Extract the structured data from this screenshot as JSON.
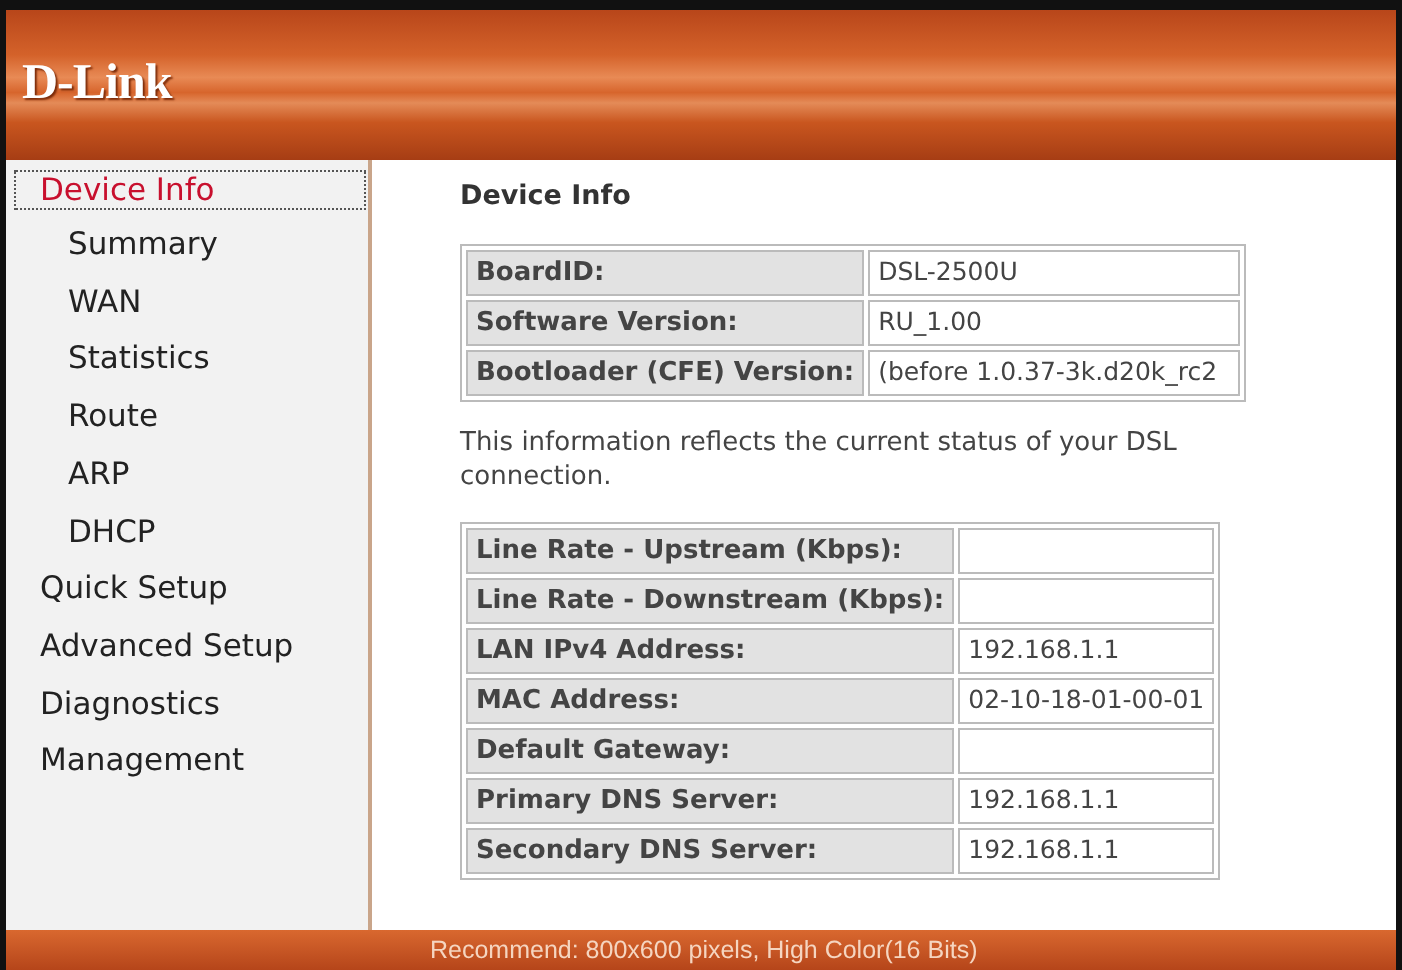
{
  "header": {
    "logo": "D-Link"
  },
  "sidebar": {
    "items": [
      {
        "label": "Device Info",
        "selected": true,
        "children": [
          {
            "label": "Summary",
            "selected": false
          },
          {
            "label": "WAN",
            "selected": false
          },
          {
            "label": "Statistics",
            "selected": false
          },
          {
            "label": "Route",
            "selected": false
          },
          {
            "label": "ARP",
            "selected": false
          },
          {
            "label": "DHCP",
            "selected": false
          }
        ]
      },
      {
        "label": "Quick Setup",
        "selected": false
      },
      {
        "label": "Advanced Setup",
        "selected": false
      },
      {
        "label": "Diagnostics",
        "selected": false
      },
      {
        "label": "Management",
        "selected": false
      }
    ]
  },
  "content": {
    "title": "Device Info",
    "info_table": [
      {
        "label": "BoardID:",
        "value": "DSL-2500U"
      },
      {
        "label": "Software Version:",
        "value": "RU_1.00"
      },
      {
        "label": "Bootloader (CFE) Version:",
        "value": "(before 1.0.37-3k.d20k_rc2"
      }
    ],
    "description": "This information reflects the current status of your DSL connection.",
    "status_table": [
      {
        "label": "Line Rate - Upstream (Kbps):"
      },
      {
        "label": "Line Rate - Downstream (Kbps):"
      },
      {
        "label": "LAN IPv4 Address:",
        "value": "192.168.1.1"
      },
      {
        "label": "MAC Address:",
        "value": "02-10-18-01-00-01"
      },
      {
        "label": "Default Gateway:"
      },
      {
        "label": "Primary DNS Server:",
        "value": "192.168.1.1"
      },
      {
        "label": "Secondary DNS Server:",
        "value": "192.168.1.1"
      }
    ]
  },
  "footer": {
    "text": "Recommend: 800x600 pixels, High Color(16 Bits)"
  }
}
